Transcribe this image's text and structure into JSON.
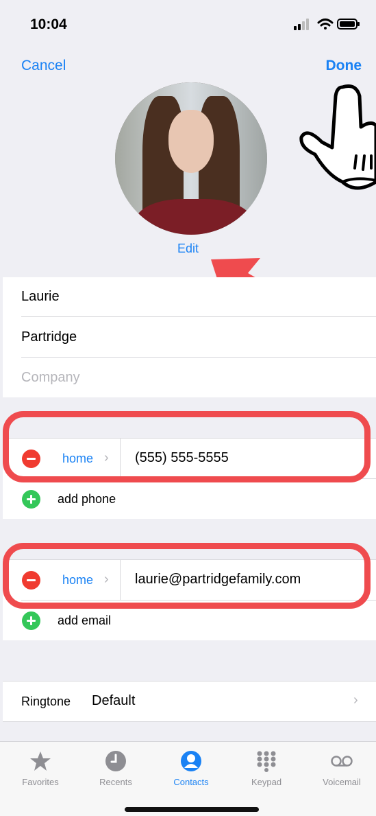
{
  "status_bar": {
    "time": "10:04"
  },
  "nav": {
    "cancel_label": "Cancel",
    "done_label": "Done"
  },
  "photo": {
    "edit_label": "Edit"
  },
  "name_fields": {
    "first_name": "Laurie",
    "last_name": "Partridge",
    "company_placeholder": "Company"
  },
  "phone": {
    "label": "home",
    "value": "(555) 555-5555",
    "add_label": "add phone"
  },
  "email": {
    "label": "home",
    "value": "laurie@partridgefamily.com",
    "add_label": "add email"
  },
  "ringtone": {
    "label": "Ringtone",
    "value": "Default"
  },
  "tab_bar": {
    "items": [
      {
        "label": "Favorites",
        "icon": "star-icon",
        "active": false
      },
      {
        "label": "Recents",
        "icon": "clock-icon",
        "active": false
      },
      {
        "label": "Contacts",
        "icon": "person-circle-icon",
        "active": true
      },
      {
        "label": "Keypad",
        "icon": "keypad-icon",
        "active": false
      },
      {
        "label": "Voicemail",
        "icon": "voicemail-icon",
        "active": false
      }
    ]
  },
  "colors": {
    "accent": "#1a82f4",
    "highlight": "#ef4b4e",
    "delete": "#f03b30",
    "add": "#34c759",
    "background": "#efeff4"
  }
}
